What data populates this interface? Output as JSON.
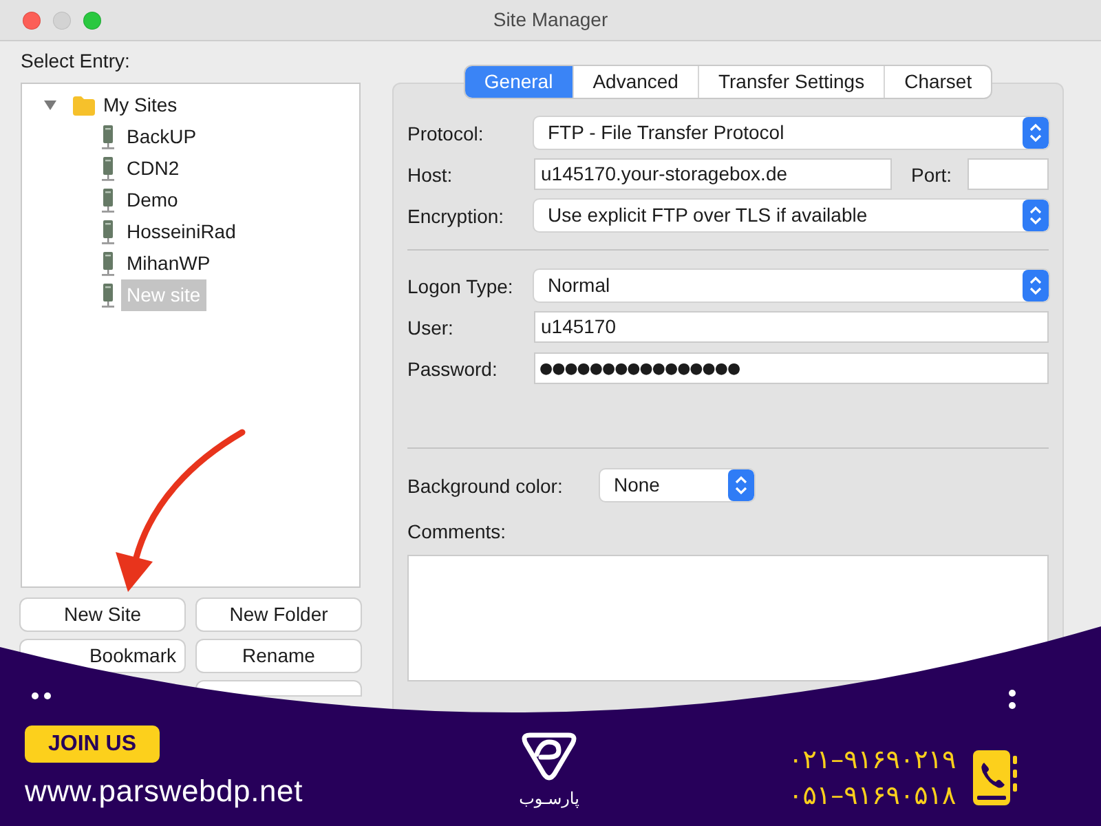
{
  "window": {
    "title": "Site Manager"
  },
  "entries": {
    "label": "Select Entry:",
    "tree": [
      {
        "kind": "folder",
        "label": "My Sites",
        "expanded": true,
        "selected": false,
        "children": [
          {
            "kind": "site",
            "label": "BackUP",
            "selected": false
          },
          {
            "kind": "site",
            "label": "CDN2",
            "selected": false
          },
          {
            "kind": "site",
            "label": "Demo",
            "selected": false
          },
          {
            "kind": "site",
            "label": "HosseiniRad",
            "selected": false
          },
          {
            "kind": "site",
            "label": "MihanWP",
            "selected": false
          },
          {
            "kind": "site",
            "label": "New site",
            "selected": true
          }
        ]
      }
    ],
    "buttons": [
      {
        "label": "New Site",
        "covered": false
      },
      {
        "label": "New Folder",
        "covered": false
      },
      {
        "label": "Bookmark",
        "covered": true
      },
      {
        "label": "Rename",
        "covered": false
      }
    ]
  },
  "tabs": [
    {
      "label": "General",
      "selected": true
    },
    {
      "label": "Advanced",
      "selected": false
    },
    {
      "label": "Transfer Settings",
      "selected": false
    },
    {
      "label": "Charset",
      "selected": false
    }
  ],
  "general": {
    "protocol": {
      "label": "Protocol:",
      "value": "FTP - File Transfer Protocol"
    },
    "host": {
      "label": "Host:",
      "value": "u145170.your-storagebox.de"
    },
    "port": {
      "label": "Port:"
    },
    "encryption": {
      "label": "Encryption:",
      "value": "Use explicit FTP over TLS if available"
    },
    "logon_type": {
      "label": "Logon Type:",
      "value": "Normal"
    },
    "user": {
      "label": "User:",
      "value": "u145170"
    },
    "password": {
      "label": "Password:",
      "value": "●●●●●●●●●●●●●●●●"
    },
    "background_color": {
      "label": "Background color:",
      "value": "None"
    },
    "comments": {
      "label": "Comments:"
    }
  },
  "banner": {
    "badge": "JOIN US",
    "website": "www.parswebdp.net",
    "logo_caption": "پارسـوب",
    "phones": [
      "۰۲۱–۹۱۶۹۰۲۱۹",
      "۰۵۱–۹۱۶۹۰۵۱۸"
    ]
  }
}
